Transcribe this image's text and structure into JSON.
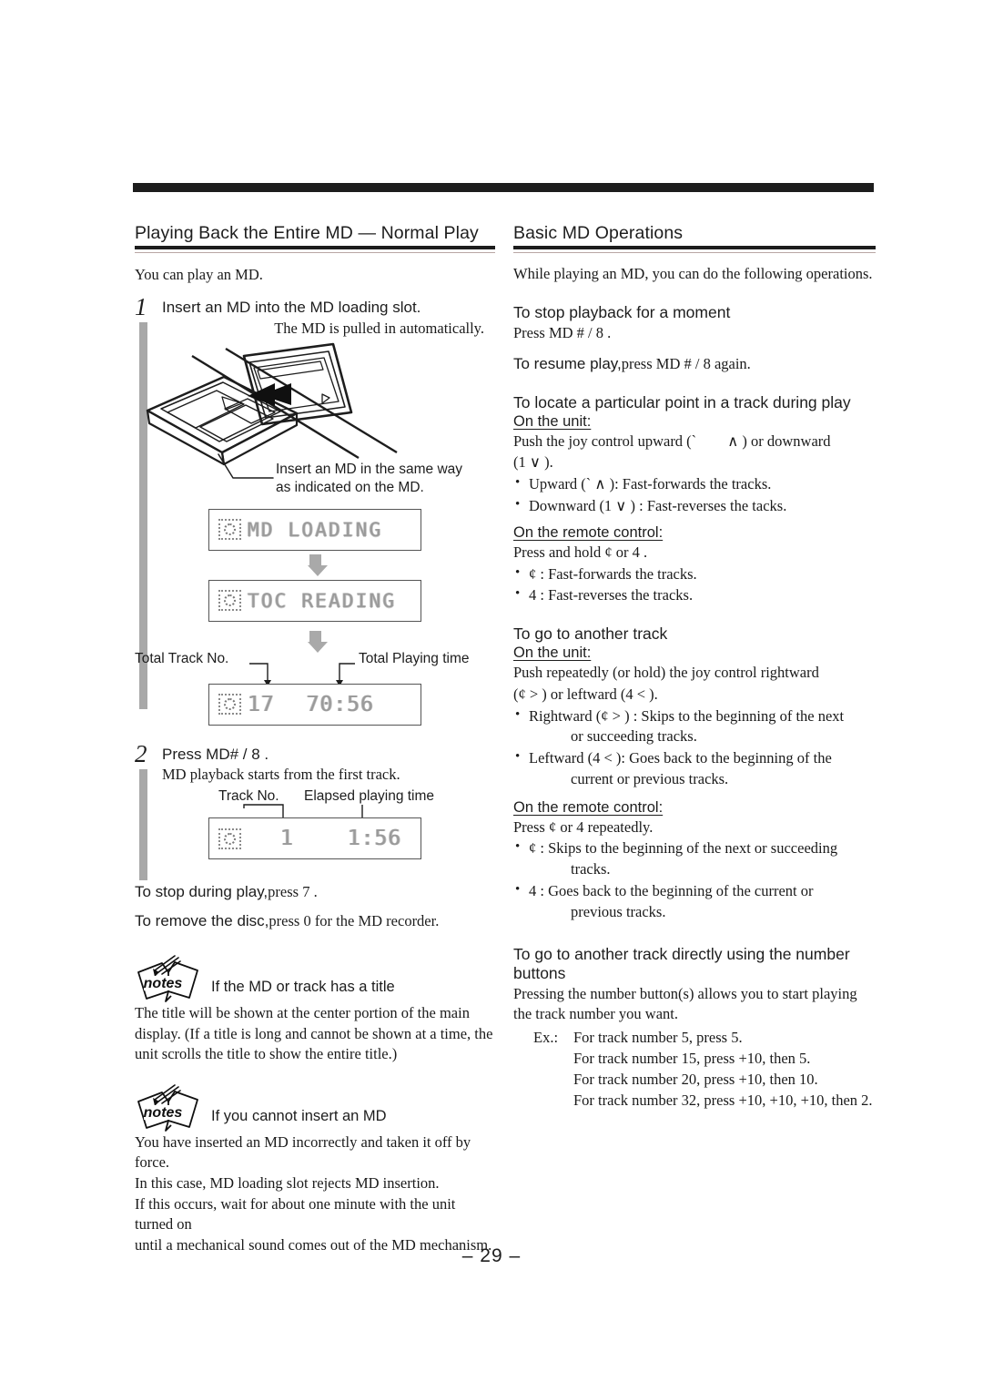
{
  "page": {
    "number_label": "– 29 –"
  },
  "left": {
    "heading": "Playing Back the Entire MD — Normal Play",
    "intro": "You can play an MD.",
    "step1": {
      "number": "1",
      "title": "Insert an MD into the MD loading slot.",
      "caption": "The MD is pulled in automatically.",
      "art_note_line1": "Insert an MD in the same way",
      "art_note_line2": "as indicated on the MD."
    },
    "displays": {
      "loading_text": "MD LOADING",
      "toc_text": "TOC READING",
      "total_label_left": "Total Track No.",
      "total_label_right": "Total Playing time",
      "total_track_no": "17",
      "total_playing_time": "70:56"
    },
    "step2": {
      "number": "2",
      "title": "Press MD#  / 8 .",
      "caption": "MD playback starts from the first track.",
      "label_track": "Track No.",
      "label_elapsed": "Elapsed playing time",
      "track_no": "1",
      "elapsed_time": "1:56"
    },
    "stop_line_a": "To stop during play,",
    "stop_line_b": "press 7 .",
    "remove_line_a": "To remove the disc,",
    "remove_line_b": "press 0  for the MD recorder.",
    "note1": {
      "icon_label": "notes",
      "title": "If the MD or track has a title",
      "body": "The title will be shown at the center portion of the main display. (If a title is long and cannot be shown at a time, the unit scrolls the title to show the entire title.)"
    },
    "note2": {
      "icon_label": "notes",
      "title": "If you cannot insert an MD",
      "body_line1": "You have inserted an MD incorrectly and taken it off by force.",
      "body_line2": "In this case, MD loading slot rejects MD insertion.",
      "body_line3": "If this occurs, wait for about one minute with the unit turned on",
      "body_line4": "until a mechanical sound comes out of the MD mechanism."
    }
  },
  "right": {
    "heading": "Basic MD Operations",
    "intro": "While playing an MD, you can do the following operations.",
    "stop_moment": {
      "heading": "To stop playback for a moment",
      "line1": "Press MD #  / 8 .",
      "resume_a": "To resume play,",
      "resume_b": "press MD #  / 8 ",
      "resume_c": "again."
    },
    "locate": {
      "heading": "To locate a particular point in a track during play",
      "unit_label": "On the unit:",
      "unit_line1_a": "Push the joy control upward (`",
      "unit_line1_b": "∧ ) or downward",
      "unit_line2": "(1      ∨ ).",
      "bullets_unit": [
        "Upward (`       ∧ ): Fast-forwards the tracks.",
        "Downward (1       ∨ ) : Fast-reverses the tacks."
      ],
      "remote_label": "On the remote control:",
      "remote_line": "Press and hold ¢      or 4    .",
      "bullets_remote": [
        "¢      : Fast-forwards the tracks.",
        "4      : Fast-reverses the tracks."
      ]
    },
    "another_track": {
      "heading": "To go to another track",
      "unit_label": "On the unit:",
      "unit_line1": "Push repeatedly (or hold) the joy control rightward",
      "unit_line2": "(¢      > ) or leftward (4       < ).",
      "bullets_unit": [
        {
          "line1": "Rightward (¢       > ) : Skips to the beginning of the next",
          "line2": "or succeeding tracks."
        },
        {
          "line1": "Leftward (4       < ): Goes back to the beginning of the",
          "line2": "current or previous tracks."
        }
      ],
      "remote_label": "On the remote control:",
      "remote_line": "Press ¢     or 4     repeatedly.",
      "bullets_remote": [
        {
          "line1": "¢      : Skips to the beginning of the next or succeeding",
          "line2": "tracks."
        },
        {
          "line1": "4      : Goes back to the beginning of the current or",
          "line2": "previous tracks."
        }
      ]
    },
    "number_buttons": {
      "heading_line1": "To go to another track directly using the number",
      "heading_line2": "buttons",
      "intro_line1": "Pressing the number button(s) allows you to start playing",
      "intro_line2": "the track number you want.",
      "ex_label": "Ex.:",
      "examples": [
        "For track number 5, press 5.",
        "For track number 15, press +10, then 5.",
        "For track number 20, press +10, then 10.",
        "For track number 32, press +10, +10, +10, then 2."
      ]
    }
  }
}
